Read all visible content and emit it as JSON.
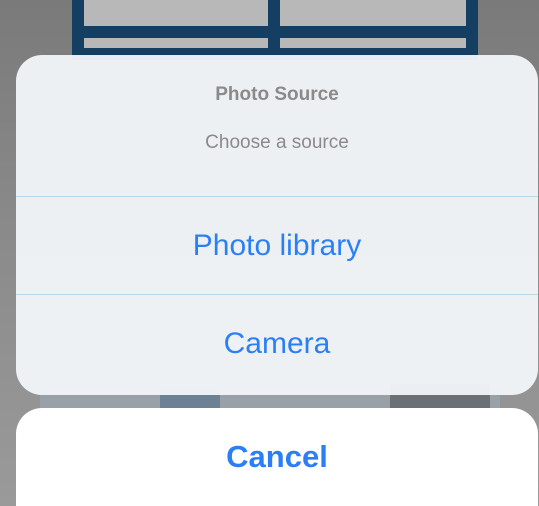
{
  "action_sheet": {
    "title": "Photo Source",
    "message": "Choose a source",
    "actions": [
      {
        "label": "Photo library"
      },
      {
        "label": "Camera"
      }
    ]
  },
  "cancel": {
    "label": "Cancel"
  },
  "colors": {
    "action_text": "#2b7ff6",
    "header_text": "#8a8a8a",
    "sheet_background": "#f0f5f8",
    "separator": "#b9d8e8"
  }
}
